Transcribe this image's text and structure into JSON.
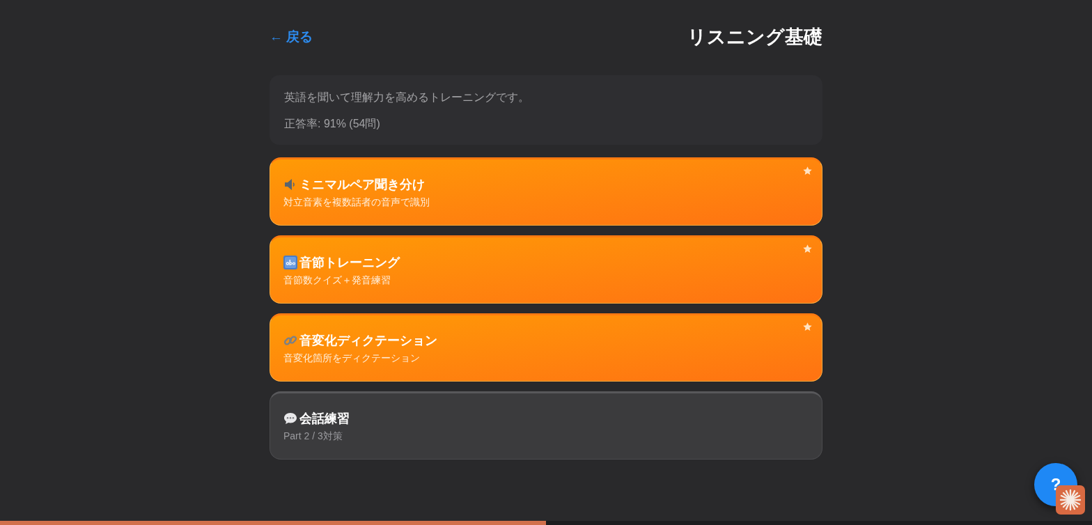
{
  "header": {
    "back_link": "← 戻る",
    "title": "リスニング基礎"
  },
  "summary": {
    "description": "英語を聞いて理解力を高めるトレーニングです。",
    "accuracy": "正答率: 91% (54問)"
  },
  "lessons": [
    {
      "title": "ミニマルペア聞き分け",
      "subtitle": "対立音素を複数話者の音声で識別",
      "starred": true
    },
    {
      "title": "音節トレーニング",
      "subtitle": "音節数クイズ＋発音練習",
      "starred": true
    },
    {
      "title": "音変化ディクテーション",
      "subtitle": "音変化箇所をディクテーション",
      "starred": true
    },
    {
      "title": "会話練習",
      "subtitle": "Part 2 / 3対策",
      "starred": false
    }
  ],
  "help_button": {
    "label": "?"
  },
  "progress": {
    "level": 0.5
  }
}
